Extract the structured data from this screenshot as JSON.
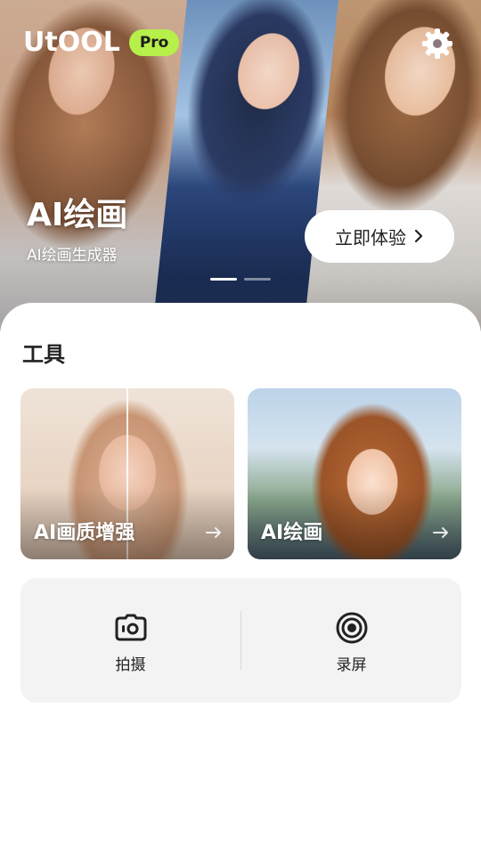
{
  "header": {
    "logo_text": "UtOOL",
    "badge": "Pro",
    "settings_icon": "gear-icon"
  },
  "hero": {
    "title": "AI绘画",
    "subtitle": "AI绘画生成器",
    "cta_label": "立即体验",
    "cta_icon": "chevron-right-icon",
    "carousel_pages": 2,
    "carousel_active_index": 0
  },
  "tools_section": {
    "title": "工具",
    "cards": [
      {
        "label": "AI画质增强",
        "icon": "arrow-right-icon"
      },
      {
        "label": "AI绘画",
        "icon": "arrow-right-icon"
      }
    ],
    "quick_tools": [
      {
        "label": "拍摄",
        "icon": "camera-icon"
      },
      {
        "label": "录屏",
        "icon": "screen-record-icon"
      }
    ]
  },
  "colors": {
    "badge_bg": "#b7f04a",
    "sheet_bg": "#ffffff",
    "tools_box_bg": "#f3f3f3",
    "text_primary": "#222222"
  }
}
